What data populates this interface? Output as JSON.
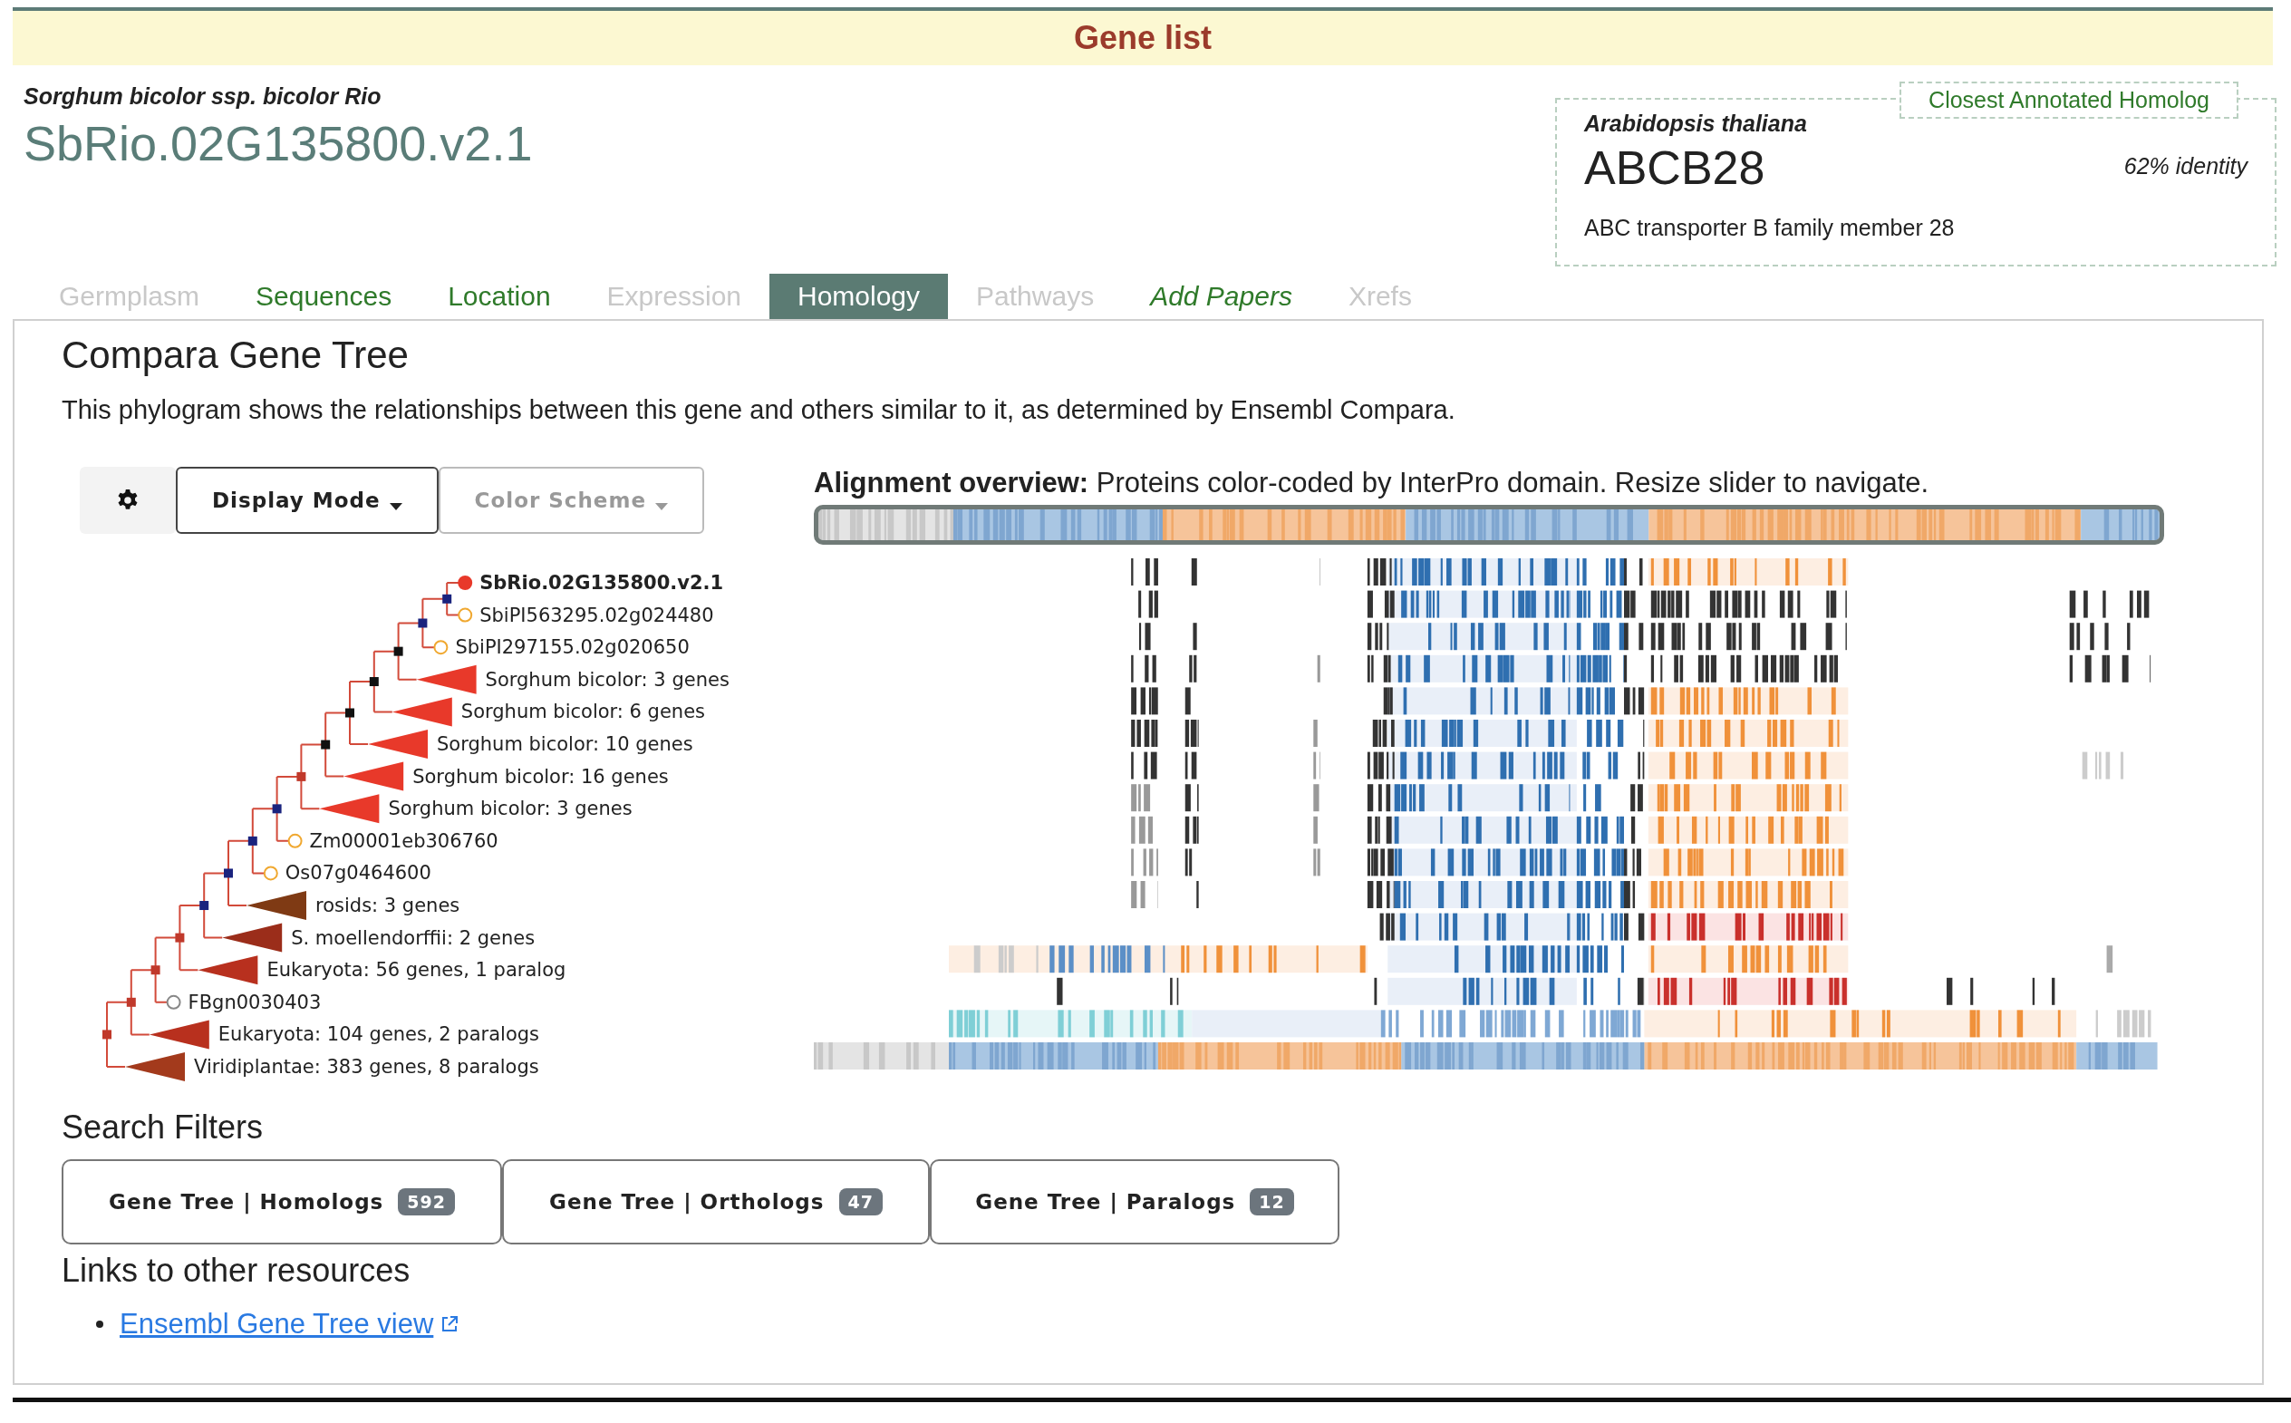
{
  "banner": {
    "title": "Gene list"
  },
  "gene": {
    "species": "Sorghum bicolor ssp. bicolor Rio",
    "id": "SbRio.02G135800.v2.1"
  },
  "homolog": {
    "label": "Closest Annotated Homolog",
    "species": "Arabidopsis thaliana",
    "symbol": "ABCB28",
    "identity": "62% identity",
    "description": "ABC transporter B family member 28"
  },
  "tabs": [
    {
      "label": "Germplasm",
      "kind": "section",
      "selected": false,
      "disabled": true
    },
    {
      "label": "Sequences",
      "kind": "section",
      "selected": false,
      "disabled": false
    },
    {
      "label": "Location",
      "kind": "section",
      "selected": false,
      "disabled": false
    },
    {
      "label": "Expression",
      "kind": "section",
      "selected": false,
      "disabled": true
    },
    {
      "label": "Homology",
      "kind": "section",
      "selected": true,
      "disabled": false
    },
    {
      "label": "Pathways",
      "kind": "section",
      "selected": false,
      "disabled": true
    },
    {
      "label": "Add Papers",
      "kind": "action",
      "selected": false,
      "disabled": false
    },
    {
      "label": "Xrefs",
      "kind": "section",
      "selected": false,
      "disabled": true
    }
  ],
  "panel": {
    "title": "Compara Gene Tree",
    "description": "This phylogram shows the relationships between this gene and others similar to it, as determined by Ensembl Compara."
  },
  "toolbar": [
    {
      "kind": "settings"
    },
    {
      "kind": "dropdown",
      "label": "Display Mode",
      "disabled": false
    },
    {
      "kind": "dropdown",
      "label": "Color Scheme",
      "disabled": true
    }
  ],
  "tree": {
    "color": "#c0392b",
    "children": [
      {
        "color": "#c0392b",
        "children": [
          {
            "color": "#c0392b",
            "children": [
              {
                "color": "#c0392b",
                "children": [
                  {
                    "color": "#1a237e",
                    "children": [
                      {
                        "color": "#1a237e",
                        "children": [
                          {
                            "color": "#1a237e",
                            "children": [
                              {
                                "color": "#1a237e",
                                "children": [
                                  {
                                    "color": "#c0392b",
                                    "children": [
                                      {
                                        "color": "#111111",
                                        "children": [
                                          {
                                            "color": "#111111",
                                            "children": [
                                              {
                                                "color": "#111111",
                                                "children": [
                                                  {
                                                    "color": "#111111",
                                                    "children": [
                                                      {
                                                        "color": "#1a237e",
                                                        "children": [
                                                          {
                                                            "color": "#1a237e",
                                                            "children": [
                                                              {
                                                                "label": "SbRio.02G135800.v2.1",
                                                                "kind": "gene",
                                                                "color": "#e8392a",
                                                                "selected": true
                                                              },
                                                              {
                                                                "label": "SbiPI563295.02g024480",
                                                                "kind": "gene",
                                                                "color": "#f0a830",
                                                                "selected": false
                                                              }
                                                            ]
                                                          },
                                                          {
                                                            "label": "SbiPI297155.02g020650",
                                                            "kind": "gene",
                                                            "color": "#f0a830",
                                                            "selected": false
                                                          }
                                                        ]
                                                      },
                                                      {
                                                        "label": "Sorghum bicolor: 3 genes",
                                                        "kind": "clade",
                                                        "color": "#e8392a",
                                                        "selected": false
                                                      }
                                                    ]
                                                  },
                                                  {
                                                    "label": "Sorghum bicolor: 6 genes",
                                                    "kind": "clade",
                                                    "color": "#e8392a",
                                                    "selected": false
                                                  }
                                                ]
                                              },
                                              {
                                                "label": "Sorghum bicolor: 10 genes",
                                                "kind": "clade",
                                                "color": "#e8392a",
                                                "selected": false
                                              }
                                            ]
                                          },
                                          {
                                            "label": "Sorghum bicolor: 16 genes",
                                            "kind": "clade",
                                            "color": "#e8392a",
                                            "selected": false
                                          }
                                        ]
                                      },
                                      {
                                        "label": "Sorghum bicolor: 3 genes",
                                        "kind": "clade",
                                        "color": "#e8392a",
                                        "selected": false
                                      }
                                    ]
                                  },
                                  {
                                    "label": "Zm00001eb306760",
                                    "kind": "gene",
                                    "color": "#f0a830",
                                    "selected": false
                                  }
                                ]
                              },
                              {
                                "label": "Os07g0464600",
                                "kind": "gene",
                                "color": "#f0a830",
                                "selected": false
                              }
                            ]
                          },
                          {
                            "label": "rosids: 3 genes",
                            "kind": "clade",
                            "color": "#7f3a14",
                            "selected": false
                          }
                        ]
                      },
                      {
                        "label": "S. moellendorffii: 2 genes",
                        "kind": "clade",
                        "color": "#9b2d1a",
                        "selected": false
                      }
                    ]
                  },
                  {
                    "label": "Eukaryota: 56 genes, 1 paralog",
                    "kind": "clade",
                    "color": "#b8301e",
                    "selected": false
                  }
                ]
              },
              {
                "label": "FBgn0030403",
                "kind": "gene",
                "color": "#888888",
                "selected": false
              }
            ]
          },
          {
            "label": "Eukaryota: 104 genes, 2 paralogs",
            "kind": "clade",
            "color": "#b8301e",
            "selected": false
          }
        ]
      },
      {
        "label": "Viridiplantae: 383 genes, 8 paralogs",
        "kind": "clade",
        "color": "#a33a1c",
        "selected": false
      }
    ]
  },
  "alignment": {
    "caption": "**Alignment overview:** Proteins color-coded by InterPro domain. Resize slider to navigate."
  },
  "filters": {
    "title": "Search Filters",
    "buttons": [
      {
        "label": "Gene Tree | Homologs",
        "count": "592"
      },
      {
        "label": "Gene Tree | Orthologs",
        "count": "47"
      },
      {
        "label": "Gene Tree | Paralogs",
        "count": "12"
      }
    ]
  },
  "links": {
    "title": "Links to other resources",
    "items": [
      {
        "label": "Ensembl Gene Tree view"
      }
    ]
  }
}
